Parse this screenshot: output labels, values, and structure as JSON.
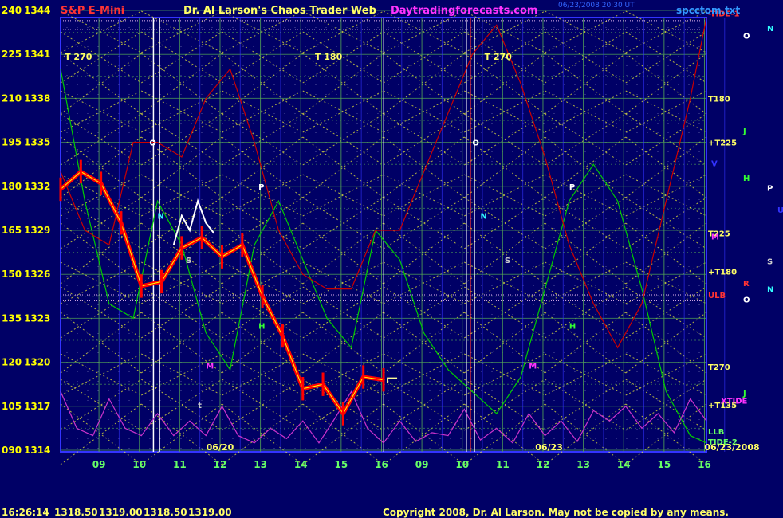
{
  "header": {
    "instrument": "S&P E-Mini",
    "site_title": "Dr. Al Larson's Chaos Trader Web",
    "site_url": "Daytradingforecasts.com",
    "timestamp": "06/23/2008 20:30 UT",
    "file_name": "spcctom.txt"
  },
  "footer": {
    "time": "16:26:14",
    "quote_open": "1318.50",
    "quote_high": "1319.00",
    "quote_low": "1318.50",
    "quote_close": "1319.00",
    "copyright": "Copyright 2008, Dr. Al Larson. May not be copied by any means."
  },
  "colors": {
    "background": "#000066",
    "price": "#ff0000",
    "price_avg": "#ffffff",
    "green_line": "#00cc00",
    "red_line": "#cc0000",
    "magenta_line": "#cc33cc",
    "grid_green": "#55aa55",
    "grid_yellow": "#ffff33",
    "grid_blue": "#3333ff",
    "text_yellow": "#ffff00",
    "site_magenta": "#ff33ff",
    "copyright_yellow": "#ffff66"
  },
  "chart_data": {
    "type": "line",
    "y_left_ticks": [
      "240",
      "225",
      "210",
      "195",
      "180",
      "165",
      "150",
      "135",
      "120",
      "105",
      "090"
    ],
    "y_right_ticks": [
      "1344",
      "1341",
      "1338",
      "1335",
      "1332",
      "1329",
      "1326",
      "1323",
      "1320",
      "1317",
      "1314"
    ],
    "ylim": [
      1314,
      1344
    ],
    "x_ticks": [
      "09",
      "10",
      "11",
      "12",
      "13",
      "14",
      "15",
      "16",
      "09",
      "10",
      "11",
      "12",
      "13",
      "14",
      "15",
      "16"
    ],
    "date_labels": [
      "06/20",
      "06/23"
    ],
    "corner_date": "06/23/2008",
    "series": [
      {
        "x": [
          0.0,
          0.5,
          1.0,
          1.5,
          2.0,
          2.5,
          3.0,
          3.5,
          4.0,
          4.5,
          5.0,
          5.5,
          6.0,
          6.5,
          7.0,
          7.5,
          8.0
        ],
        "y": [
          1331.8,
          1333.0,
          1332.2,
          1329.5,
          1325.2,
          1325.5,
          1327.8,
          1328.5,
          1327.2,
          1328.0,
          1324.5,
          1321.8,
          1318.2,
          1318.5,
          1316.5,
          1319.0,
          1318.8
        ]
      },
      {
        "x": [
          2.8,
          3.0,
          3.2,
          3.4,
          3.6,
          3.8
        ],
        "y": [
          1328.0,
          1330.0,
          1329.0,
          1331.0,
          1329.5,
          1328.8
        ]
      }
    ],
    "right_labels": [
      {
        "text": "-TIDE-1",
        "y": 1343.8,
        "color": "#ff3333"
      },
      {
        "text": "T180",
        "y": 1338.0,
        "color": "#ffff66"
      },
      {
        "text": "+T225",
        "y": 1335.0,
        "color": "#ffff66"
      },
      {
        "text": "T225",
        "y": 1328.8,
        "color": "#ffff66"
      },
      {
        "text": "+T180",
        "y": 1326.2,
        "color": "#ffff66"
      },
      {
        "text": "ULB",
        "y": 1324.6,
        "color": "#ff3333"
      },
      {
        "text": "T270",
        "y": 1319.7,
        "color": "#ffff66"
      },
      {
        "text": "+T135",
        "y": 1317.1,
        "color": "#ffff66"
      },
      {
        "text": "XTIDE",
        "y": 1317.4,
        "color": "#ff33ff"
      },
      {
        "text": "LLB",
        "y": 1315.3,
        "color": "#66ff66"
      },
      {
        "text": "TIDE-2",
        "y": 1314.6,
        "color": "#66ff66"
      }
    ],
    "top_labels": [
      {
        "text": "T 270",
        "x": 0.1
      },
      {
        "text": "T 180",
        "x": 6.3
      },
      {
        "text": "T 270",
        "x": 10.5
      }
    ],
    "planet_markers": [
      {
        "text": "O",
        "x": 2.2,
        "y": 1335.0,
        "color": "#ffffff"
      },
      {
        "text": "N",
        "x": 2.4,
        "y": 1330.0,
        "color": "#33ffff"
      },
      {
        "text": "S",
        "x": 3.1,
        "y": 1327.0,
        "color": "#cccccc"
      },
      {
        "text": "M",
        "x": 3.6,
        "y": 1319.8,
        "color": "#ff33ff"
      },
      {
        "text": "P",
        "x": 4.9,
        "y": 1332.0,
        "color": "#ffffff"
      },
      {
        "text": "H",
        "x": 4.9,
        "y": 1322.5,
        "color": "#33ff33"
      },
      {
        "text": "t",
        "x": 3.4,
        "y": 1317.1,
        "color": "#cccccc"
      },
      {
        "text": "O",
        "x": 10.2,
        "y": 1335.0,
        "color": "#ffffff"
      },
      {
        "text": "N",
        "x": 10.4,
        "y": 1330.0,
        "color": "#33ffff"
      },
      {
        "text": "S",
        "x": 11.0,
        "y": 1327.0,
        "color": "#cccccc"
      },
      {
        "text": "M",
        "x": 11.6,
        "y": 1319.8,
        "color": "#ff33ff"
      },
      {
        "text": "P",
        "x": 12.6,
        "y": 1332.0,
        "color": "#ffffff"
      },
      {
        "text": "H",
        "x": 12.6,
        "y": 1322.5,
        "color": "#33ff33"
      }
    ],
    "side_markers": [
      {
        "text": "N",
        "y": 1342.8,
        "col": 2,
        "color": "#33ffff"
      },
      {
        "text": "O",
        "y": 1342.3,
        "col": 1,
        "color": "#ffffff"
      },
      {
        "text": "J",
        "y": 1335.8,
        "col": 1,
        "color": "#33ff33"
      },
      {
        "text": "V",
        "y": 1333.6,
        "col": 0,
        "color": "#3333ff"
      },
      {
        "text": "H",
        "y": 1332.6,
        "col": 1,
        "color": "#33ff33"
      },
      {
        "text": "P",
        "y": 1331.9,
        "col": 2,
        "color": "#ffffff"
      },
      {
        "text": "U",
        "y": 1330.4,
        "col": 3,
        "color": "#3333ff"
      },
      {
        "text": "M",
        "y": 1328.6,
        "col": 0,
        "color": "#ff33ff"
      },
      {
        "text": "S",
        "y": 1326.9,
        "col": 2,
        "color": "#cccccc"
      },
      {
        "text": "R",
        "y": 1325.4,
        "col": 1,
        "color": "#ff3333"
      },
      {
        "text": "N",
        "y": 1325.0,
        "col": 2,
        "color": "#33ffff"
      },
      {
        "text": "O",
        "y": 1324.3,
        "col": 1,
        "color": "#ffffff"
      },
      {
        "text": "J",
        "y": 1317.9,
        "col": 1,
        "color": "#33ff33"
      }
    ]
  }
}
